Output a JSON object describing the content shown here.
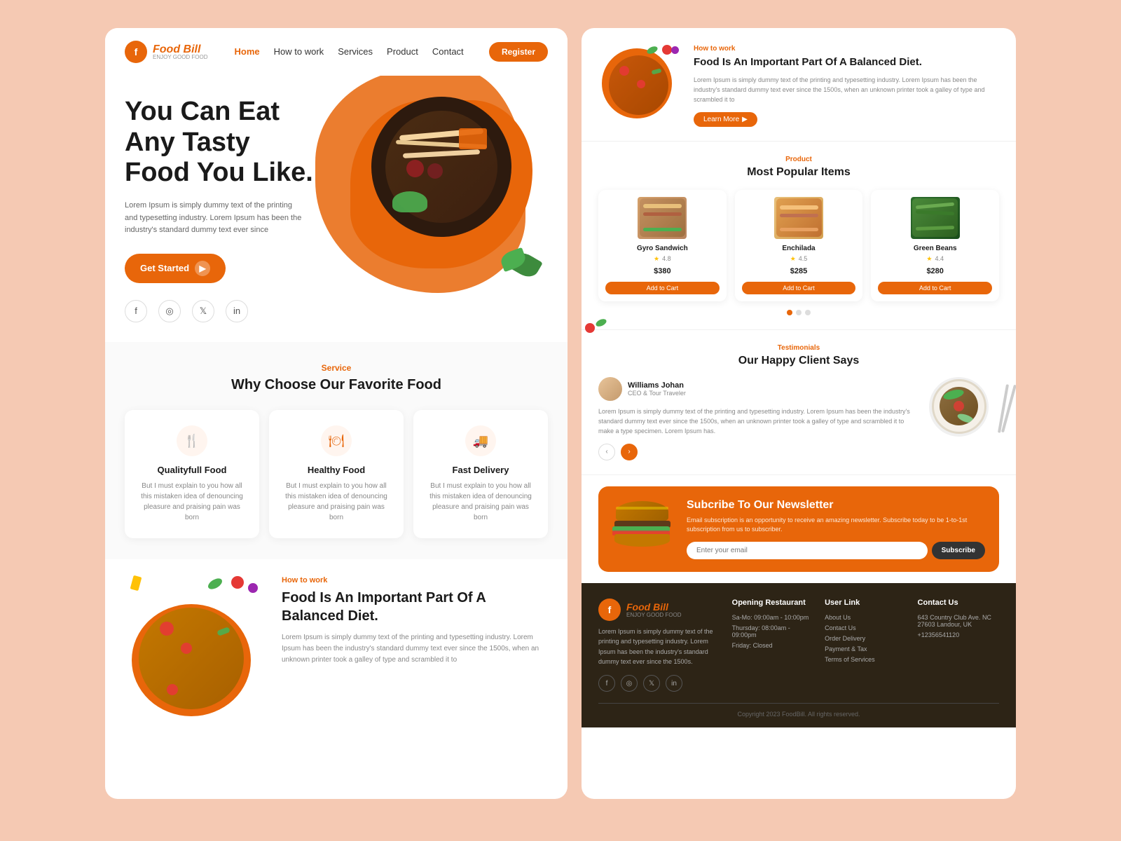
{
  "brand": {
    "name": "Food Bill",
    "tagline": "ENJOY GOOD FOOD",
    "logo_char": "f"
  },
  "nav": {
    "links": [
      "Home",
      "How to work",
      "Services",
      "Product",
      "Contact"
    ],
    "active_link": "Home",
    "register_label": "Register"
  },
  "hero": {
    "title": "You Can Eat Any Tasty Food You Like.",
    "description": "Lorem Ipsum is simply dummy text of the printing and typesetting industry. Lorem Ipsum has been the industry's standard dummy text ever since",
    "cta_label": "Get Started",
    "socials": [
      "f",
      "ig",
      "tw",
      "in"
    ]
  },
  "service": {
    "label": "Service",
    "title": "Why Choose Our Favorite Food",
    "cards": [
      {
        "icon": "🍴",
        "title": "Qualityfull Food",
        "desc": "But I must explain to you how all this mistaken idea of denouncing pleasure and praising pain was born"
      },
      {
        "icon": "🍽",
        "title": "Healthy Food",
        "desc": "But I must explain to you how all this mistaken idea of denouncing pleasure and praising pain was born"
      },
      {
        "icon": "🚚",
        "title": "Fast Delivery",
        "desc": "But I must explain to you how all this mistaken idea of denouncing pleasure and praising pain was born"
      }
    ]
  },
  "how_to_work": {
    "label": "How to work",
    "title": "Food Is An Important Part Of A Balanced Diet.",
    "description": "Lorem Ipsum is simply dummy text of the printing and typesetting industry. Lorem Ipsum has been the industry's standard dummy text ever since the 1500s, when an unknown printer took a galley of type and scrambled it to",
    "learn_more": "Learn More"
  },
  "popular": {
    "label": "Product",
    "title": "Most Popular Items",
    "items": [
      {
        "name": "Gyro Sandwich",
        "rating": "4.8",
        "price": "$380"
      },
      {
        "name": "Enchilada",
        "rating": "4.5",
        "price": "$285"
      },
      {
        "name": "Green Beans",
        "rating": "4.4",
        "price": "$280"
      }
    ],
    "add_to_cart": "Add to Cart"
  },
  "testimonial": {
    "label": "Testimonials",
    "title": "Our Happy Client Says",
    "reviewer": {
      "name": "Williams Johan",
      "title": "CEO & Tour Traveler"
    },
    "quote": "Lorem Ipsum is simply dummy text of the printing and typesetting industry. Lorem Ipsum has been the industry's standard dummy text ever since the 1500s, when an unknown printer took a galley of type and scrambled it to make a type specimen. Lorem Ipsum has."
  },
  "newsletter": {
    "title": "Subcribe To Our Newsletter",
    "description": "Email subscription is an opportunity to receive an amazing newsletter. Subscribe today to be 1-to-1st subscription from us to subscriber.",
    "input_placeholder": "Enter your email",
    "submit_label": "Subscribe"
  },
  "footer": {
    "about_desc": "Lorem Ipsum is simply dummy text of the printing and typesetting industry. Lorem Ipsum has been the industry's standard dummy text ever since the 1500s.",
    "opening": {
      "title": "Opening Restaurant",
      "hours": [
        "Sa-Mo: 09:00am - 10:00pm",
        "Thursday: 08:00am - 09:00pm",
        "Friday: Closed"
      ]
    },
    "user_links": {
      "title": "User Link",
      "links": [
        "About Us",
        "Contact Us",
        "Order Delivery",
        "Payment & Tax",
        "Terms of Services"
      ]
    },
    "contact": {
      "title": "Contact Us",
      "address": "643 Country Club Ave. NC 27603 Landour, UK",
      "phone": "+12356541120"
    },
    "socials": [
      "f",
      "ig",
      "tw",
      "in"
    ],
    "copyright": "Copyright 2023 FoodBill. All rights reserved."
  }
}
